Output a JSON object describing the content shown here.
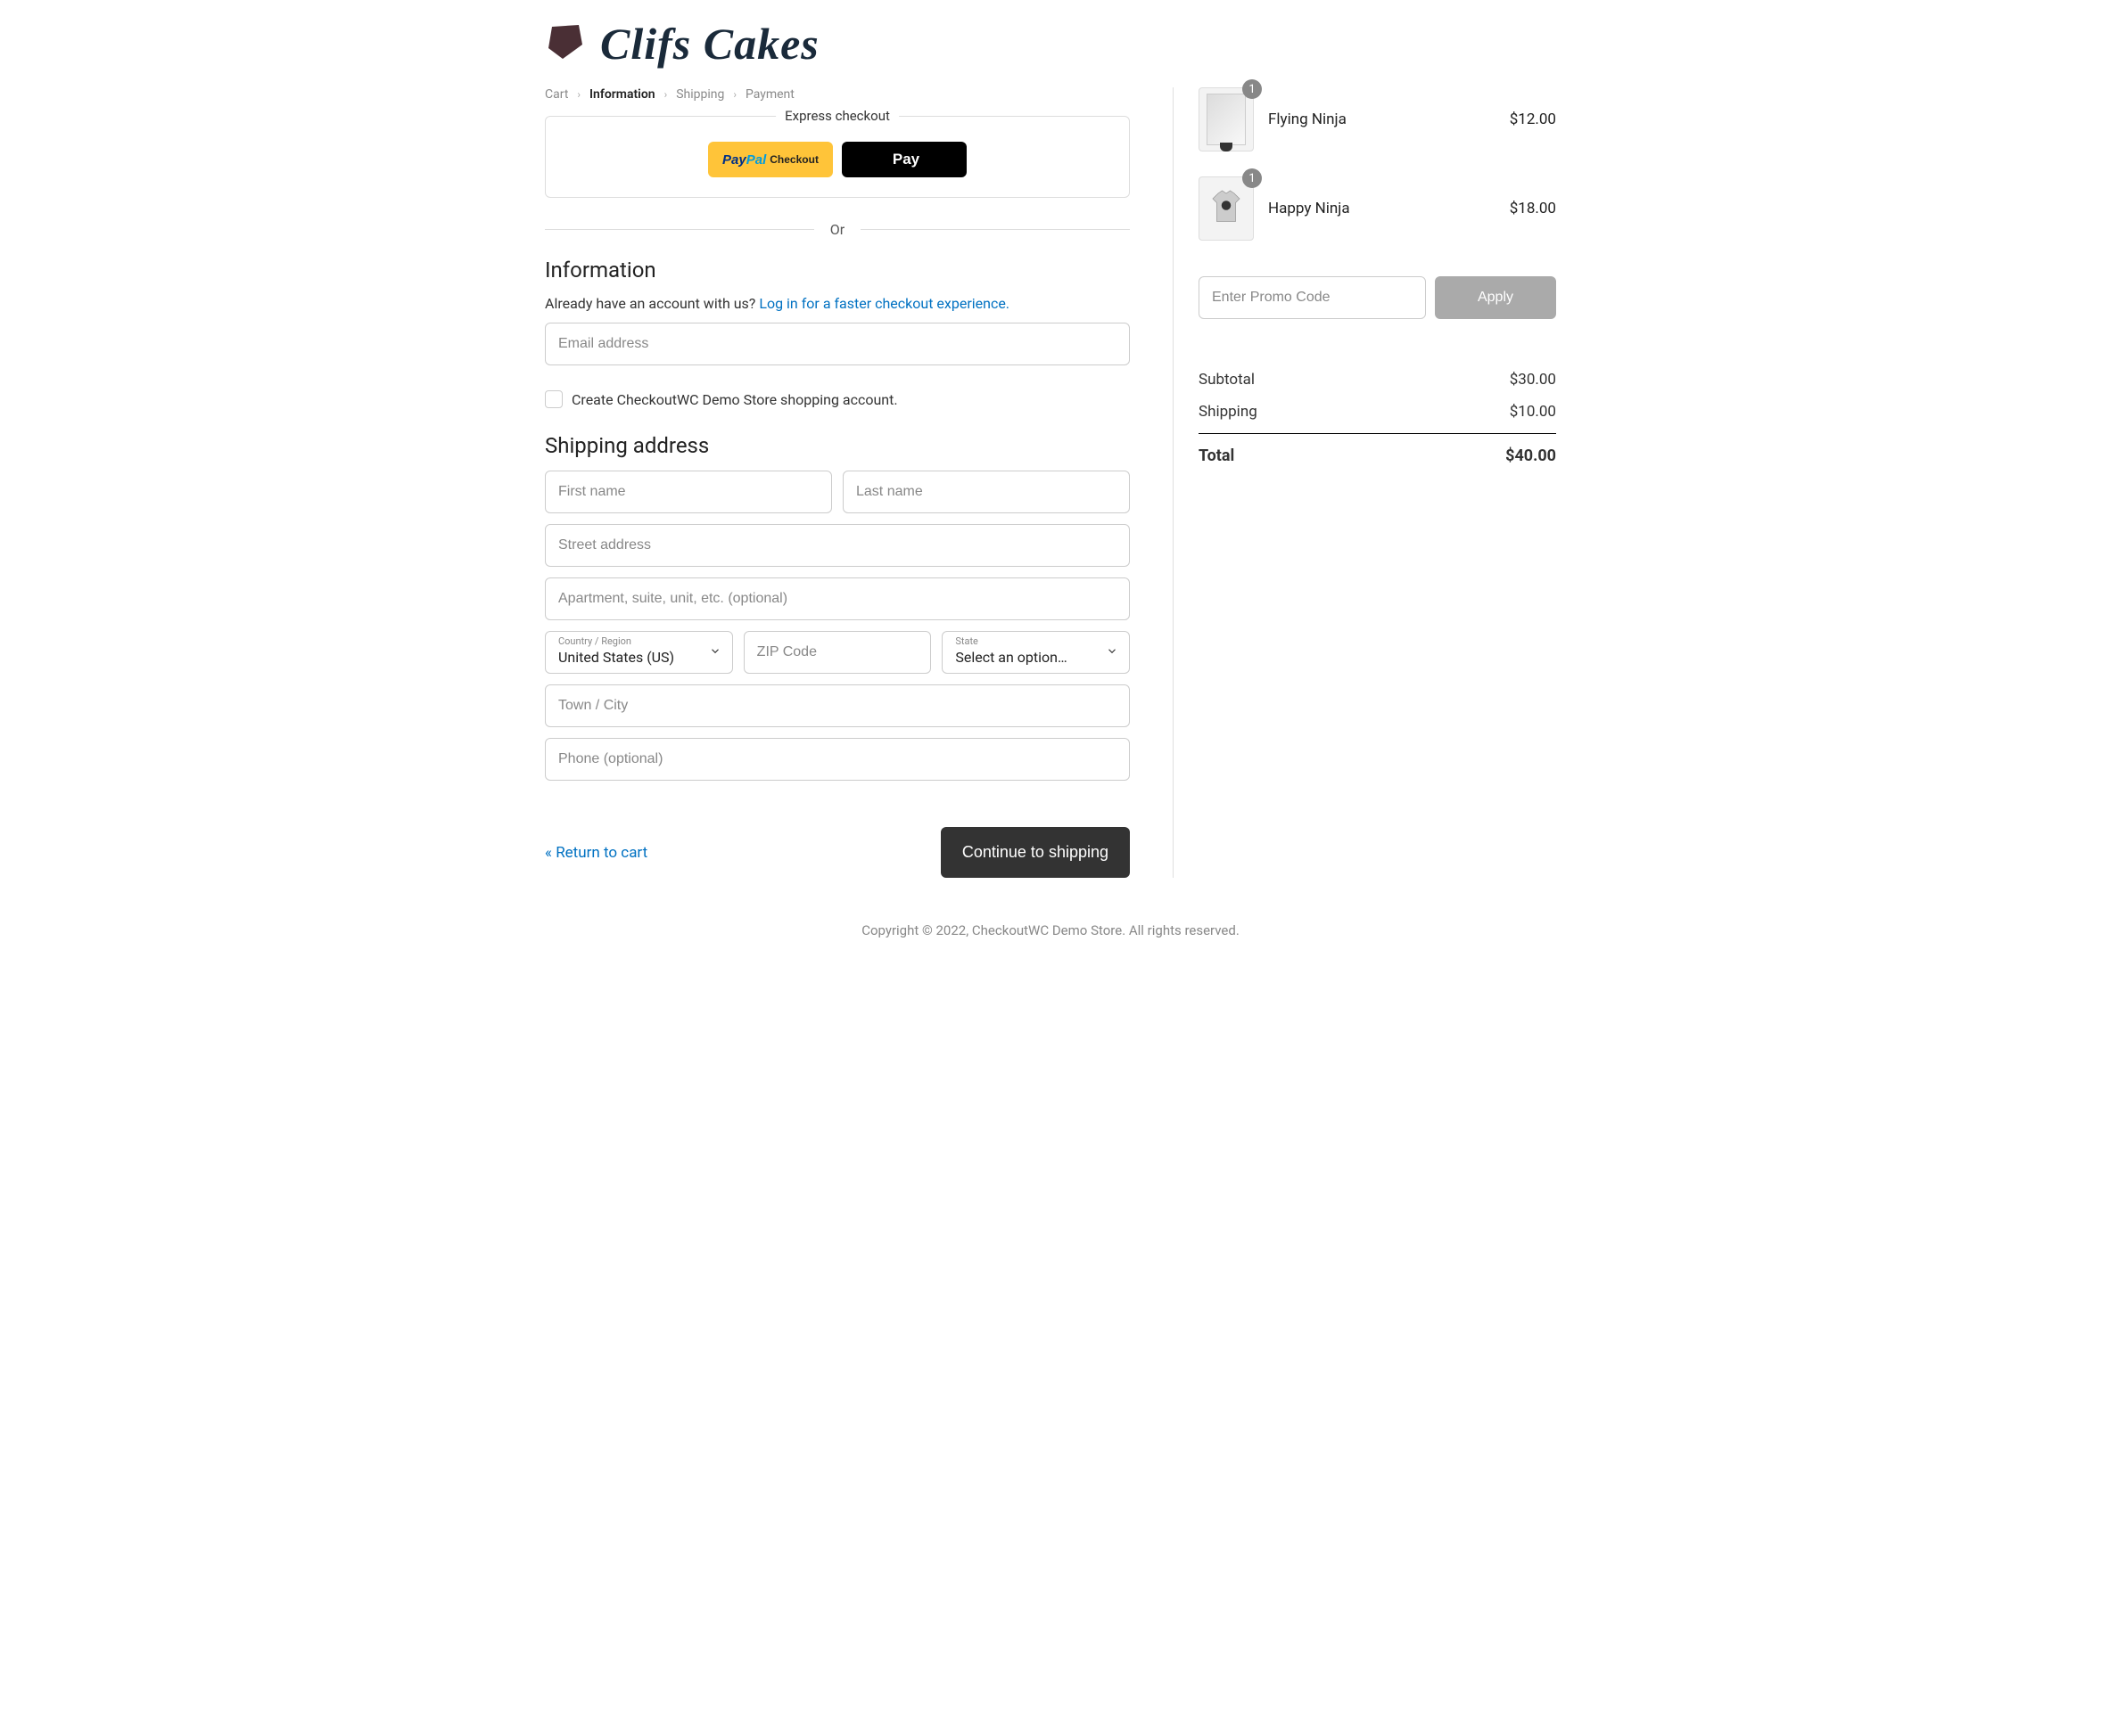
{
  "brand": "Clifs Cakes",
  "breadcrumbs": {
    "items": [
      "Cart",
      "Information",
      "Shipping",
      "Payment"
    ],
    "active_index": 1
  },
  "express": {
    "label": "Express checkout",
    "paypal_checkout": "Checkout",
    "apple_pay": "Pay"
  },
  "divider_or": "Or",
  "information": {
    "heading": "Information",
    "prompt_prefix": "Already have an account with us? ",
    "login_link": "Log in for a faster checkout experience.",
    "email_placeholder": "Email address",
    "create_account_label": "Create CheckoutWC Demo Store shopping account."
  },
  "shipping": {
    "heading": "Shipping address",
    "first_name_placeholder": "First name",
    "last_name_placeholder": "Last name",
    "street_placeholder": "Street address",
    "apt_placeholder": "Apartment, suite, unit, etc. (optional)",
    "country_label": "Country / Region",
    "country_value": "United States (US)",
    "zip_placeholder": "ZIP Code",
    "state_label": "State",
    "state_value": "Select an option…",
    "city_placeholder": "Town / City",
    "phone_placeholder": "Phone (optional)"
  },
  "nav": {
    "return_label": "« Return to cart",
    "continue_label": "Continue to shipping"
  },
  "cart": {
    "items": [
      {
        "name": "Flying Ninja",
        "qty": "1",
        "price": "$12.00"
      },
      {
        "name": "Happy Ninja",
        "qty": "1",
        "price": "$18.00"
      }
    ],
    "promo_placeholder": "Enter Promo Code",
    "apply_label": "Apply",
    "subtotal_label": "Subtotal",
    "subtotal_value": "$30.00",
    "shipping_label": "Shipping",
    "shipping_value": "$10.00",
    "total_label": "Total",
    "total_value": "$40.00"
  },
  "footer": "Copyright © 2022, CheckoutWC Demo Store. All rights reserved."
}
